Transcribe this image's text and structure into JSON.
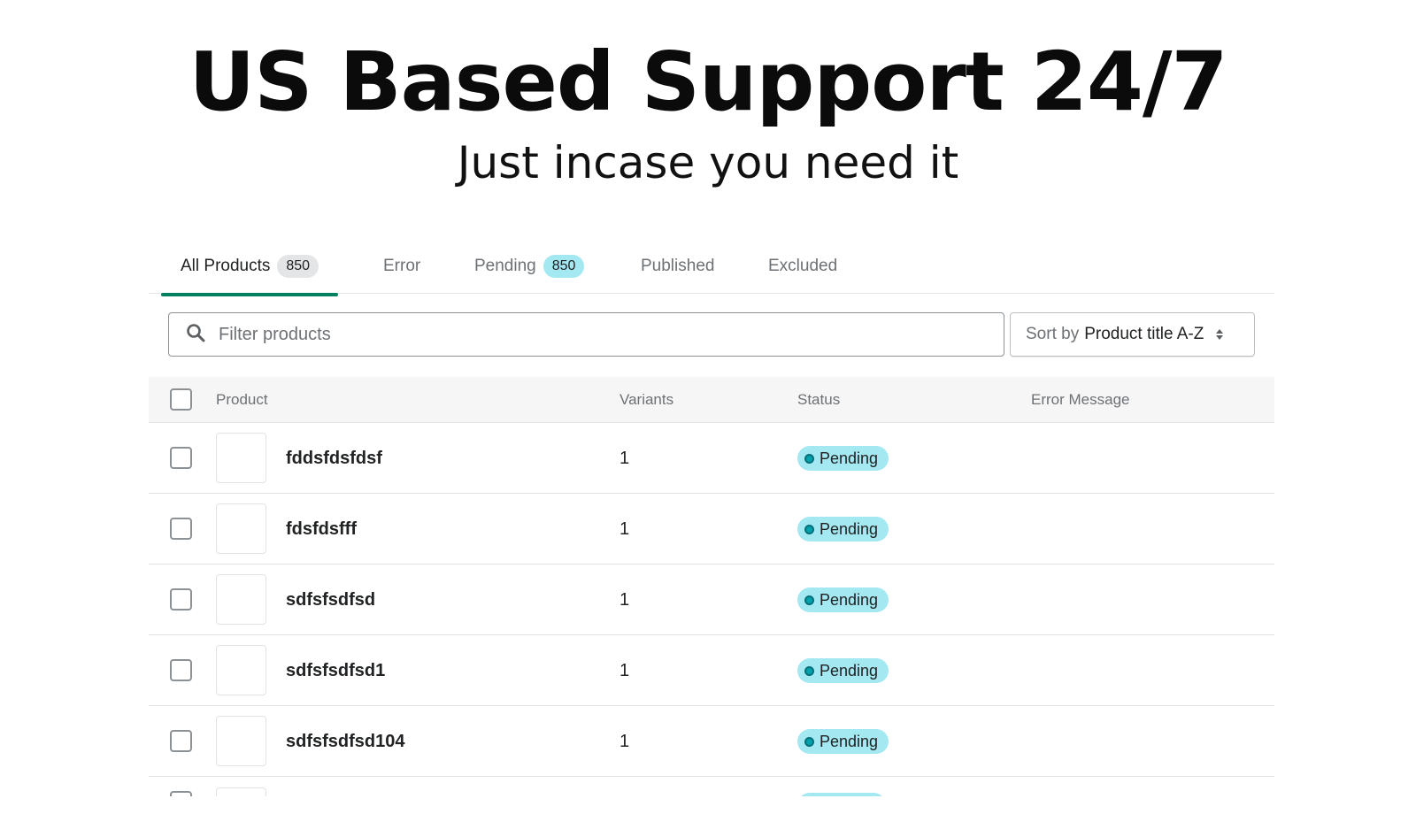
{
  "hero": {
    "title": "US Based Support 24/7",
    "subtitle": "Just incase you need it"
  },
  "tabs": [
    {
      "label": "All Products",
      "count": "850",
      "active": true
    },
    {
      "label": "Error"
    },
    {
      "label": "Pending",
      "count": "850"
    },
    {
      "label": "Published"
    },
    {
      "label": "Excluded"
    }
  ],
  "filter": {
    "placeholder": "Filter products",
    "icon": "search-icon"
  },
  "sort": {
    "label": "Sort by",
    "value": "Product title A-Z"
  },
  "table": {
    "columns": [
      "Product",
      "Variants",
      "Status",
      "Error Message"
    ],
    "rows": [
      {
        "product": "fddsfdsfdsf",
        "variants": "1",
        "status": "Pending",
        "error": ""
      },
      {
        "product": "fdsfdsfff",
        "variants": "1",
        "status": "Pending",
        "error": ""
      },
      {
        "product": "sdfsfsdfsd",
        "variants": "1",
        "status": "Pending",
        "error": ""
      },
      {
        "product": "sdfsfsdfsd1",
        "variants": "1",
        "status": "Pending",
        "error": ""
      },
      {
        "product": "sdfsfsdfsd104",
        "variants": "1",
        "status": "Pending",
        "error": ""
      }
    ]
  },
  "colors": {
    "accent": "#008060",
    "pending_badge": "#a4e8f2",
    "pending_dot": "#00a0ac"
  }
}
